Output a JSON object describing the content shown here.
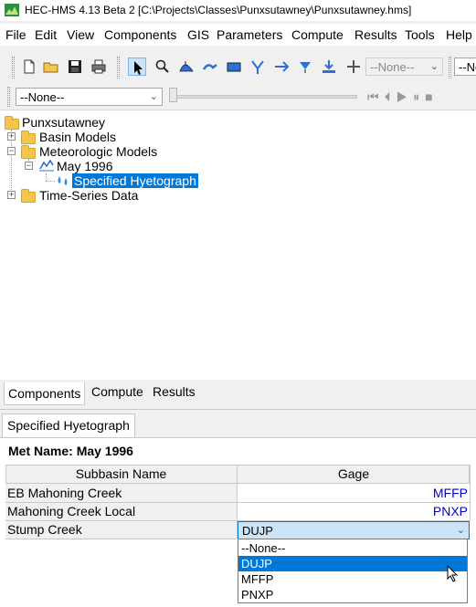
{
  "window": {
    "title": "HEC-HMS 4.13 Beta 2 [C:\\Projects\\Classes\\Punxsutawney\\Punxsutawney.hms]"
  },
  "menu": [
    "File",
    "Edit",
    "View",
    "Components",
    "GIS",
    "Parameters",
    "Compute",
    "Results",
    "Tools",
    "Help"
  ],
  "toolbar": {
    "combo_none_1": "--None--",
    "combo_none_2": "--No",
    "run_select": "--None--"
  },
  "tree": {
    "root": "Punxsutawney",
    "basin_models": "Basin Models",
    "met_models": "Meteorologic Models",
    "met_may": "May 1996",
    "specified_hyeto": "Specified Hyetograph",
    "time_series": "Time-Series Data"
  },
  "tabs": {
    "components": "Components",
    "compute": "Compute",
    "results": "Results"
  },
  "editor": {
    "tab_label": "Specified Hyetograph",
    "met_name_label": "Met Name:",
    "met_name_value": "May 1996",
    "columns": [
      "Subbasin Name",
      "Gage"
    ],
    "rows": [
      {
        "subbasin": "EB Mahoning Creek",
        "gage": "MFFP"
      },
      {
        "subbasin": "Mahoning Creek Local",
        "gage": "PNXP"
      },
      {
        "subbasin": "Stump Creek",
        "gage": "DUJP"
      }
    ],
    "dropdown_options": [
      "--None--",
      "DUJP",
      "MFFP",
      "PNXP"
    ],
    "dropdown_selected": "DUJP"
  },
  "colors": {
    "selection": "#0078d7",
    "link_text": "#0000cc",
    "folder": "#f5c54d"
  }
}
